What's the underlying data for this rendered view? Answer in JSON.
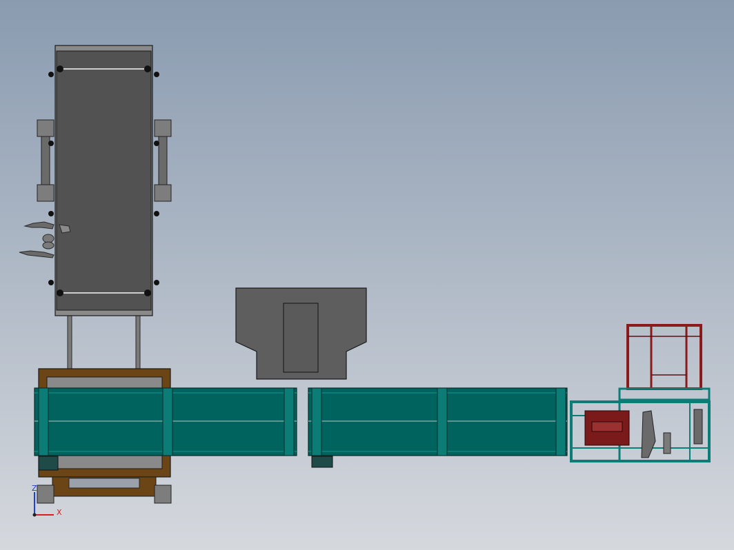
{
  "background": {
    "top": "#8a9bb0",
    "bottom": "#d5d8dd"
  },
  "colors": {
    "belt_gray": "#525252",
    "frame_gray": "#8a8a8a",
    "conveyor_teal": "#00635e",
    "conveyor_teal_light": "#0b7d76",
    "brown_frame": "#6b4516",
    "red_frame": "#8b1a1a",
    "hopper_gray": "#5e5e5e",
    "outline": "#1a1a1a"
  },
  "triad": {
    "z_label": "Z",
    "x_label": "X",
    "z_color": "#1f3fd6",
    "x_color": "#d02020"
  }
}
